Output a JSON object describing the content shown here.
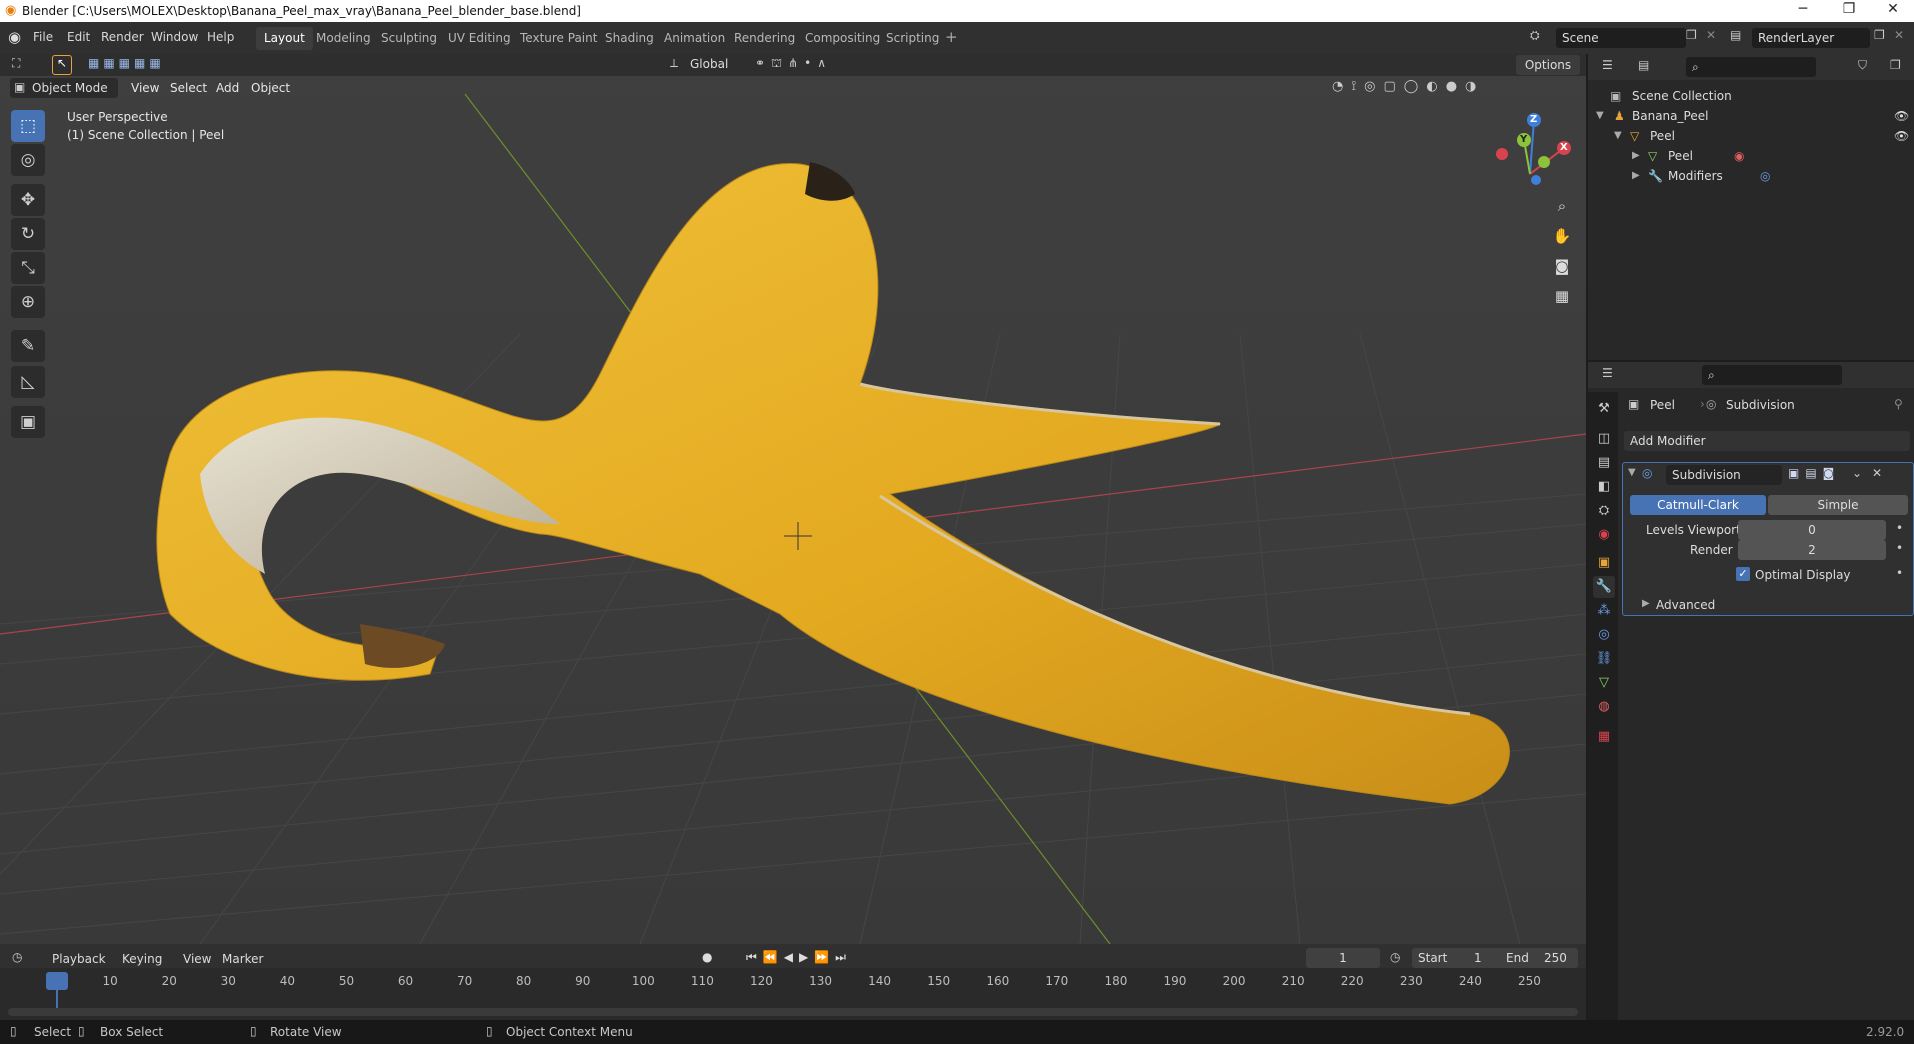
{
  "window": {
    "title": "Blender [C:\\Users\\MOLEX\\Desktop\\Banana_Peel_max_vray\\Banana_Peel_blender_base.blend]",
    "min": "─",
    "restore": "❐",
    "close": "✕"
  },
  "menu": {
    "file": "File",
    "edit": "Edit",
    "render": "Render",
    "window": "Window",
    "help": "Help"
  },
  "workspaces": [
    "Layout",
    "Modeling",
    "Sculpting",
    "UV Editing",
    "Texture Paint",
    "Shading",
    "Animation",
    "Rendering",
    "Compositing",
    "Scripting"
  ],
  "scene": {
    "name": "Scene",
    "render_layer": "RenderLayer"
  },
  "toolbar": {
    "orientation": "Global",
    "options": "Options"
  },
  "viewport": {
    "mode": "Object Mode",
    "view": "View",
    "select": "Select",
    "add": "Add",
    "object": "Object",
    "perspective": "User Perspective",
    "collection_info": "(1) Scene Collection | Peel",
    "gizmo": {
      "z": "Z",
      "y": "Y",
      "x": "X"
    }
  },
  "tools": [
    {
      "icon": "select-box-icon",
      "glyph": "⬚"
    },
    {
      "icon": "cursor-icon",
      "glyph": "◎"
    },
    {
      "icon": "move-icon",
      "glyph": "✥"
    },
    {
      "icon": "rotate-icon",
      "glyph": "↻"
    },
    {
      "icon": "scale-icon",
      "glyph": "⤡"
    },
    {
      "icon": "transform-icon",
      "glyph": "⊕"
    },
    {
      "icon": "annotate-icon",
      "glyph": "✎"
    },
    {
      "icon": "measure-icon",
      "glyph": "📐"
    },
    {
      "icon": "add-cube-icon",
      "glyph": "▣"
    }
  ],
  "outliner": {
    "root": "Scene Collection",
    "items": [
      {
        "label": "Banana_Peel"
      },
      {
        "label": "Peel"
      },
      {
        "label": "Peel"
      },
      {
        "label": "Modifiers"
      }
    ]
  },
  "properties": {
    "object": "Peel",
    "modifier_crumb": "Subdivision",
    "add_modifier": "Add Modifier",
    "modifier_name": "Subdivision",
    "catmull": "Catmull-Clark",
    "simple": "Simple",
    "levels_viewport_label": "Levels Viewport",
    "levels_viewport": "0",
    "render_label": "Render",
    "render": "2",
    "optimal_display": "Optimal Display",
    "advanced": "Advanced"
  },
  "timeline": {
    "playback": "Playback",
    "keying": "Keying",
    "view": "View",
    "marker": "Marker",
    "current": "1",
    "start_label": "Start",
    "start": "1",
    "end_label": "End",
    "end": "250",
    "frames": [
      "1",
      "10",
      "20",
      "30",
      "40",
      "50",
      "60",
      "70",
      "80",
      "90",
      "100",
      "110",
      "120",
      "130",
      "140",
      "150",
      "160",
      "170",
      "180",
      "190",
      "200",
      "210",
      "220",
      "230",
      "240",
      "250"
    ]
  },
  "status": {
    "select": "Select",
    "box_select": "Box Select",
    "rotate": "Rotate View",
    "context": "Object Context Menu",
    "version": "2.92.0"
  },
  "colors": {
    "accent": "#4772b3",
    "banana": "#e8b224",
    "x_axis": "#d9434e",
    "y_axis": "#8bc43a",
    "z_axis": "#3f7fd9"
  }
}
